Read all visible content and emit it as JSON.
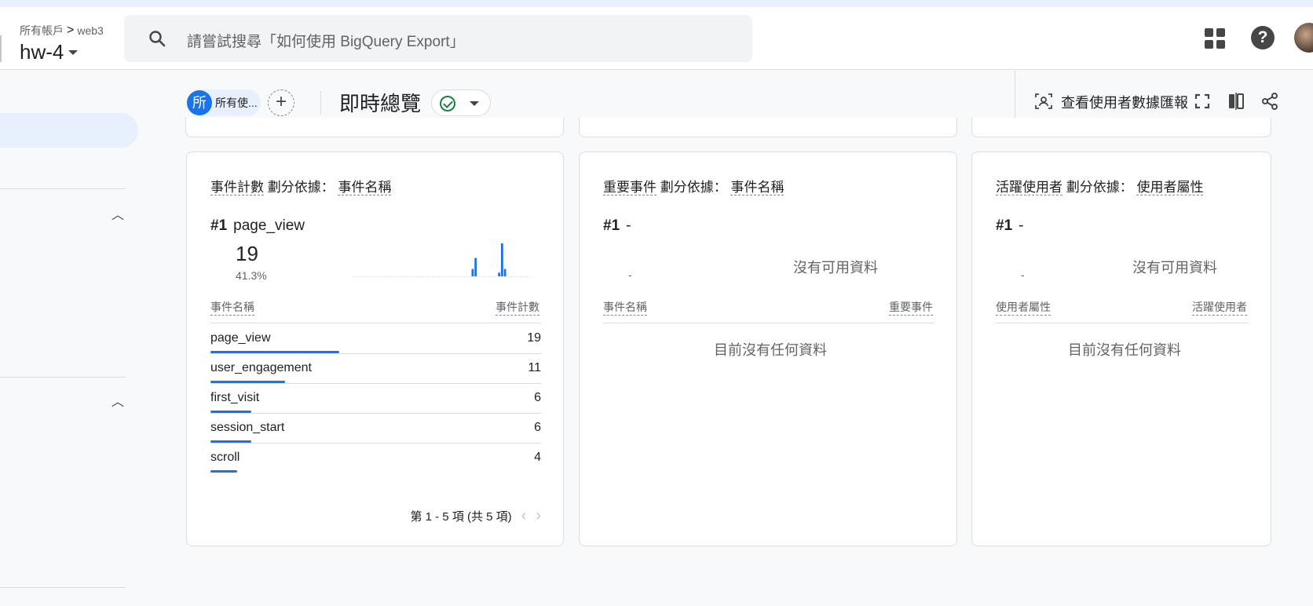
{
  "header": {
    "breadcrumb_root": "所有帳戶",
    "breadcrumb_sep": ">",
    "breadcrumb_property": "web3",
    "account_name": "hw-4",
    "search_placeholder": "請嘗試搜尋「如何使用 BigQuery Export」"
  },
  "toolbar": {
    "chip_initial": "所",
    "chip_label": "所有使...",
    "add_symbol": "+",
    "page_title": "即時總覽",
    "user_snapshot_label": "查看使用者數據匯報"
  },
  "cards": [
    {
      "title_metric": "事件計數",
      "title_by": "劃分依據：",
      "title_dim": "事件名稱",
      "rank": "#1",
      "top_item": "page_view",
      "top_value": "19",
      "top_percent": "41.3%",
      "col_left": "事件名稱",
      "col_right": "事件計數",
      "rows": [
        {
          "label": "page_view",
          "value": "19",
          "share": 1.0
        },
        {
          "label": "user_engagement",
          "value": "11",
          "share": 0.58
        },
        {
          "label": "first_visit",
          "value": "6",
          "share": 0.32
        },
        {
          "label": "session_start",
          "value": "6",
          "share": 0.32
        },
        {
          "label": "scroll",
          "value": "4",
          "share": 0.21
        }
      ],
      "pager": "第 1 - 5 項 (共 5 項)"
    },
    {
      "title_metric": "重要事件",
      "title_by": "劃分依據：",
      "title_dim": "事件名稱",
      "rank": "#1",
      "top_item": "-",
      "top_value_dash": "-",
      "no_data": "沒有可用資料",
      "col_left": "事件名稱",
      "col_right": "重要事件",
      "no_rows": "目前沒有任何資料"
    },
    {
      "title_metric": "活躍使用者",
      "title_by": "劃分依據：",
      "title_dim": "使用者屬性",
      "rank": "#1",
      "top_item": "-",
      "top_value_dash": "-",
      "no_data": "沒有可用資料",
      "col_left": "使用者屬性",
      "col_right": "活躍使用者",
      "no_rows": "目前沒有任何資料"
    }
  ],
  "sparkline": {
    "values": [
      0,
      0,
      0,
      0,
      0,
      0,
      0,
      0,
      0,
      0,
      0,
      0,
      0,
      0,
      0,
      0,
      0,
      0,
      0,
      0,
      0,
      0,
      0,
      0,
      0,
      0,
      0,
      0,
      0,
      0,
      0,
      0,
      0,
      0,
      0,
      0,
      0,
      0,
      0,
      0,
      2,
      5,
      0,
      0,
      0,
      0,
      0,
      0,
      0,
      1,
      9,
      2,
      0,
      0,
      0,
      0,
      0,
      0,
      0,
      0
    ],
    "max": 9,
    "color": "#1a73e8"
  },
  "colors": {
    "accent": "#1a73e8",
    "success": "#188038"
  }
}
